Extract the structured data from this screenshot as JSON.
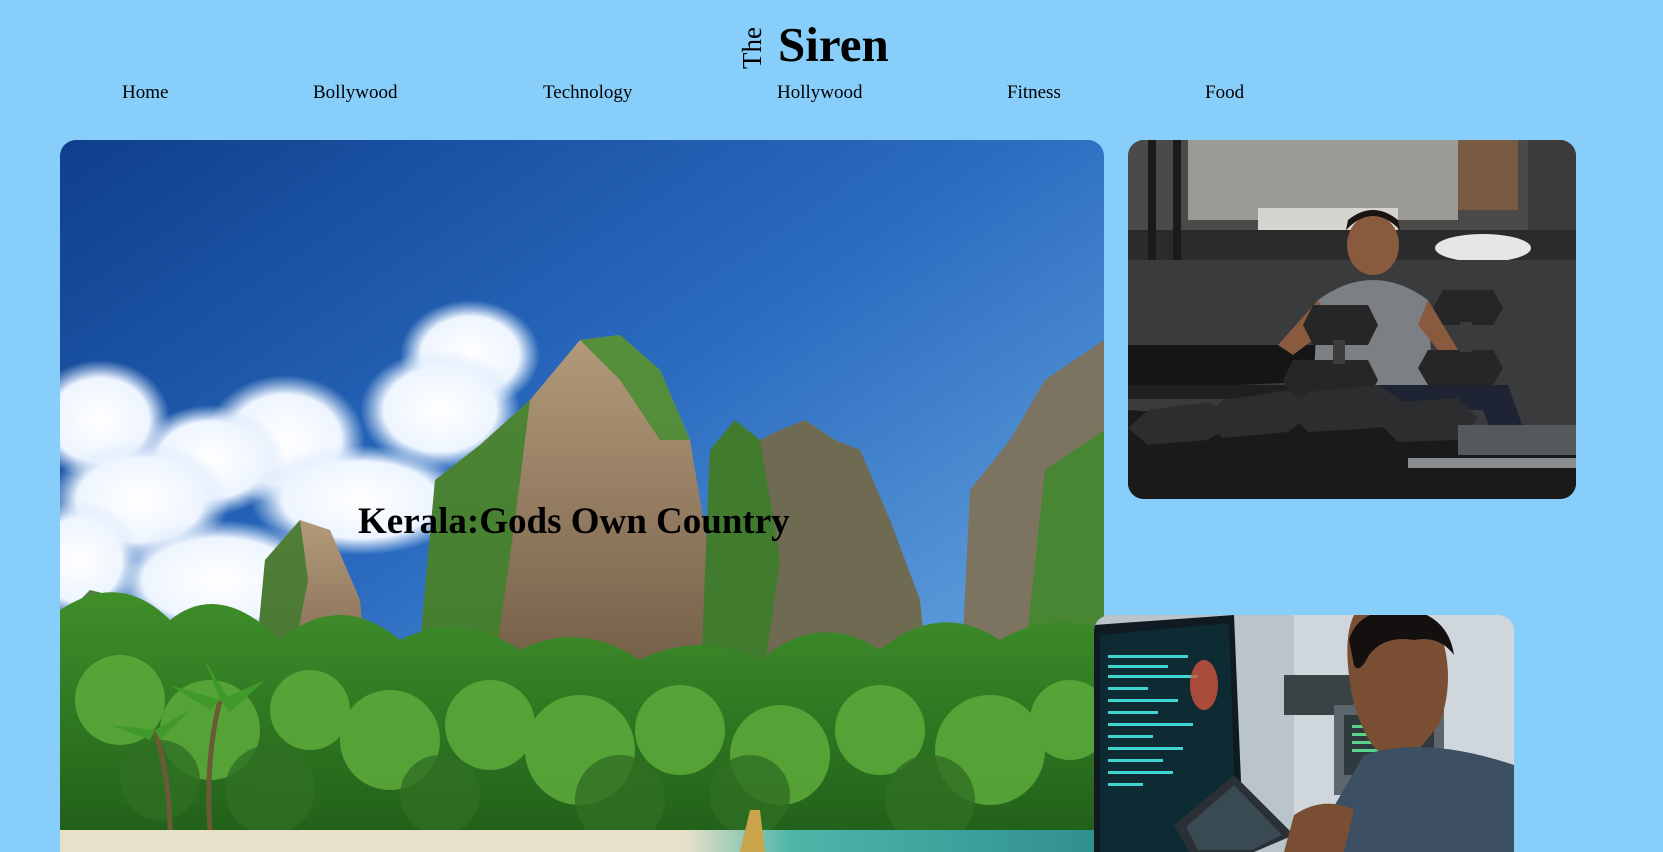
{
  "logo": {
    "prefix": "The",
    "name": "Siren"
  },
  "nav": {
    "items": [
      {
        "label": "Home"
      },
      {
        "label": "Bollywood"
      },
      {
        "label": "Technology"
      },
      {
        "label": "Hollywood"
      },
      {
        "label": "Fitness"
      },
      {
        "label": "Food"
      }
    ]
  },
  "hero": {
    "title": "Kerala:Gods Own Country",
    "image": "tropical-cliffs-beach-photo"
  },
  "cards": [
    {
      "image": "man-lifting-dumbbells-gym-photo"
    },
    {
      "image": "man-coding-at-computer-photo"
    }
  ],
  "colors": {
    "page_background": "#87cefa",
    "text": "#000000"
  }
}
